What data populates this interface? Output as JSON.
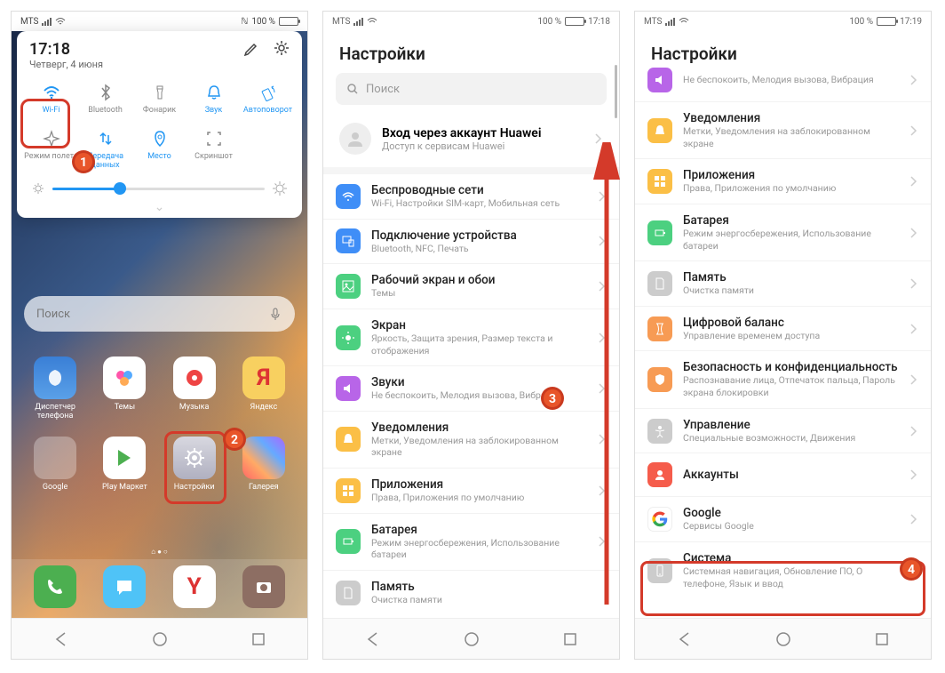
{
  "status": {
    "carrier": "MTS",
    "nfc": "ℕ",
    "battery": "100 %",
    "time1": "17:18",
    "time2": "17:18",
    "time3": "17:19"
  },
  "np": {
    "time": "17:18",
    "date": "Четверг, 4 июня",
    "qs": {
      "wifi": "Wi-Fi",
      "bluetooth": "Bluetooth",
      "torch": "Фонарик",
      "sound": "Звук",
      "rotate": "Автоповорот",
      "airplane": "Режим полета",
      "data": "Передача данных",
      "location": "Место",
      "screenshot": "Скриншот"
    }
  },
  "hs": {
    "search": "Поиск",
    "apps": {
      "phone_mgr": "Диспетчер телефона",
      "themes": "Темы",
      "music": "Музыка",
      "yandex": "Яндекс",
      "google": "Google",
      "play": "Play Маркет",
      "settings": "Настройки",
      "gallery": "Галерея"
    }
  },
  "settings": {
    "title": "Настройки",
    "search": "Поиск",
    "account": {
      "title": "Вход через аккаунт Huawei",
      "sub": "Доступ к сервисам Huawei"
    },
    "wireless": {
      "title": "Беспроводные сети",
      "sub": "Wi-Fi, Настройки SIM-карт, Мобильная сеть"
    },
    "devices": {
      "title": "Подключение устройства",
      "sub": "Bluetooth, NFC, Печать"
    },
    "home": {
      "title": "Рабочий экран и обои",
      "sub": "Темы"
    },
    "display": {
      "title": "Экран",
      "sub": "Яркость, Защита зрения, Размер текста и отображения"
    },
    "sounds": {
      "title": "Звуки",
      "sub": "Не беспокоить, Мелодия вызова, Вибрация"
    },
    "notif": {
      "title": "Уведомления",
      "sub": "Метки, Уведомления на заблокированном экране"
    },
    "apps": {
      "title": "Приложения",
      "sub": "Права, Приложения по умолчанию"
    },
    "battery": {
      "title": "Батарея",
      "sub": "Режим энергосбережения, Использование батареи"
    },
    "storage": {
      "title": "Память",
      "sub": "Очистка памяти"
    },
    "balance": {
      "title": "Цифровой баланс",
      "sub": "Управление временем доступа"
    },
    "security": {
      "title": "Безопасность и конфиденциальность",
      "sub": "Распознавание лица, Отпечаток пальца, Пароль экрана блокировки"
    },
    "assist": {
      "title": "Управление",
      "sub": "Специальные возможности, Движения"
    },
    "accounts": {
      "title": "Аккаунты",
      "sub": ""
    },
    "google": {
      "title": "Google",
      "sub": "Сервисы Google"
    },
    "system": {
      "title": "Система",
      "sub": "Системная навигация, Обновление ПО, О телефоне, Язык и ввод"
    },
    "sounds_partial": {
      "sub": "Не беспокоить, Мелодия вызова, Вибрация"
    }
  },
  "badges": {
    "b1": "1",
    "b2": "2",
    "b3": "3",
    "b4": "4"
  }
}
